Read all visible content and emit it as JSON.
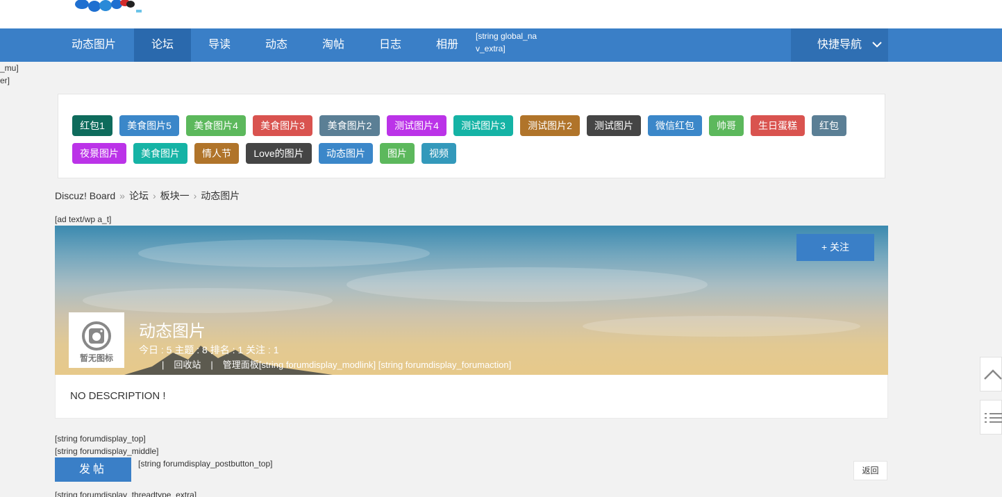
{
  "nav": {
    "items": [
      "动态图片",
      "论坛",
      "导读",
      "动态",
      "淘帖",
      "日志",
      "相册"
    ],
    "active_index": 1,
    "extra": "[string global_nav_extra]",
    "quick_nav": "快捷导航"
  },
  "left_fragments": [
    "_mu]",
    "er]"
  ],
  "tags": [
    {
      "label": "红包1",
      "color": "#0e6b5c"
    },
    {
      "label": "美食图片5",
      "color": "#3b87c9"
    },
    {
      "label": "美食图片4",
      "color": "#5cb85c"
    },
    {
      "label": "美食图片3",
      "color": "#d9534f"
    },
    {
      "label": "美食图片2",
      "color": "#5b7f95"
    },
    {
      "label": "测试图片4",
      "color": "#bb33e8"
    },
    {
      "label": "测试图片3",
      "color": "#15b3a5"
    },
    {
      "label": "测试图片2",
      "color": "#b0742a"
    },
    {
      "label": "测试图片",
      "color": "#454545"
    },
    {
      "label": "微信红包",
      "color": "#3b87c9"
    },
    {
      "label": "帅哥",
      "color": "#5cb85c"
    },
    {
      "label": "生日蛋糕",
      "color": "#d9534f"
    },
    {
      "label": "红包",
      "color": "#5b7f95"
    },
    {
      "label": "夜景图片",
      "color": "#bb33e8"
    },
    {
      "label": "美食图片",
      "color": "#15b3a5"
    },
    {
      "label": "情人节",
      "color": "#b0742a"
    },
    {
      "label": "Love的图片",
      "color": "#454545"
    },
    {
      "label": "动态图片",
      "color": "#3b87c9"
    },
    {
      "label": "图片",
      "color": "#5cb85c"
    },
    {
      "label": "视频",
      "color": "#3399bb"
    }
  ],
  "breadcrumb": {
    "items": [
      "Discuz! Board",
      "论坛",
      "板块一",
      "动态图片"
    ],
    "separators": [
      "»",
      "›",
      "›"
    ]
  },
  "ad_text": "[ad text/wp a_t]",
  "forum": {
    "follow_label": "+ 关注",
    "thumb_text": "暂无图标",
    "title": "动态图片",
    "stats": "今日 : 5   主题 : 8   排名 : 1   关注 : 1",
    "pipe": "|",
    "recycle": "回收站",
    "manage": "管理面板",
    "modlink": "[string forumdisplay_modlink] [string forumdisplay_forumaction]"
  },
  "description": "NO DESCRIPTION !",
  "strings": {
    "top": "[string forumdisplay_top]",
    "middle": "[string forumdisplay_middle]",
    "postbutton_top": "[string forumdisplay_postbutton_top]",
    "threadtype_extra": "[string forumdisplay_threadtype_extra]"
  },
  "post_button": "发帖",
  "back_button": "返回",
  "colors": {
    "nav_bg": "#3a7fc7",
    "nav_active": "#2a69ad",
    "page_bg": "#f2f2f2"
  }
}
